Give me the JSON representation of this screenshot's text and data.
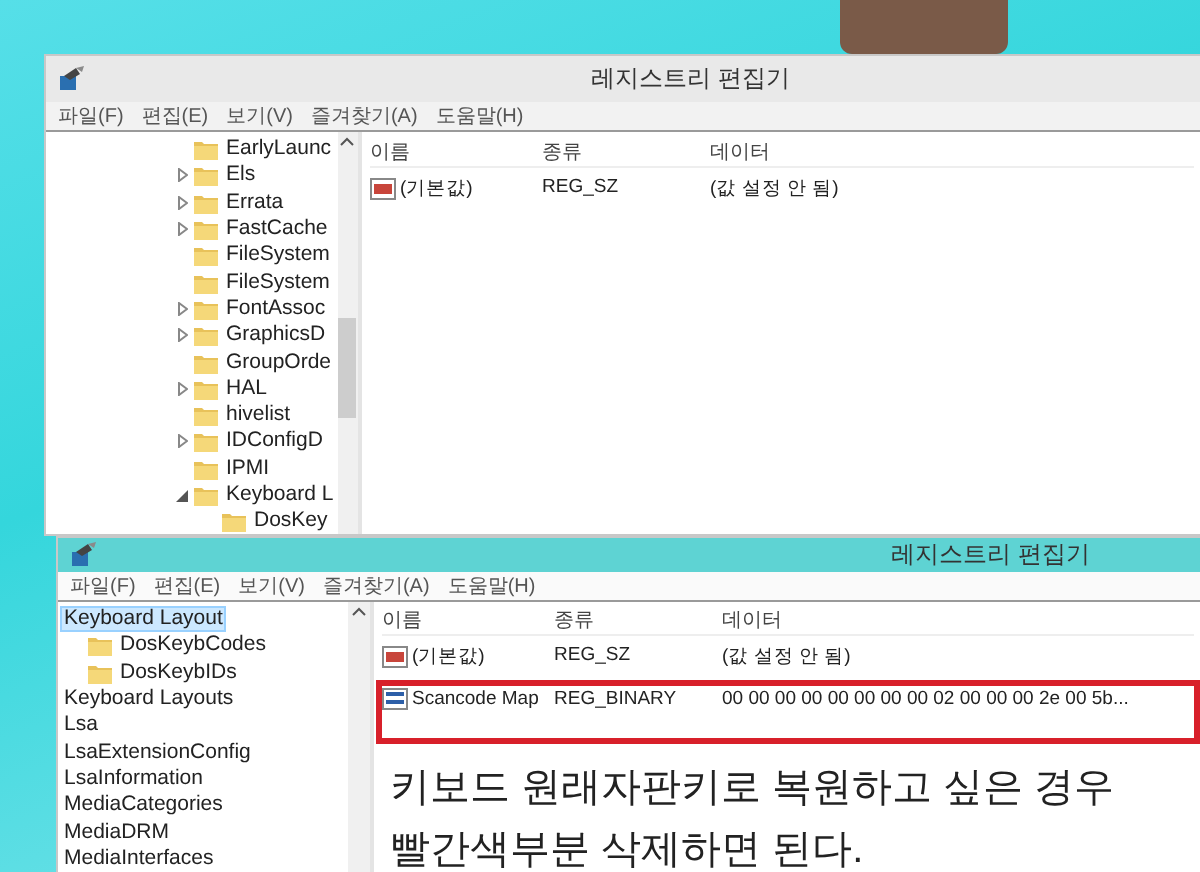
{
  "windows": [
    {
      "title": "레지스트리 편집기",
      "active": false,
      "menu": [
        "파일(F)",
        "편집(E)",
        "보기(V)",
        "즐겨찾기(A)",
        "도움말(H)"
      ],
      "tree": [
        {
          "label": "EarlyLaunc",
          "kind": "leaf",
          "selected": false
        },
        {
          "label": "Els",
          "kind": "collapsed",
          "selected": false
        },
        {
          "label": "Errata",
          "kind": "collapsed",
          "selected": false
        },
        {
          "label": "FastCache",
          "kind": "collapsed",
          "selected": false
        },
        {
          "label": "FileSystem",
          "kind": "leaf",
          "selected": false
        },
        {
          "label": "FileSystem",
          "kind": "leaf",
          "selected": false
        },
        {
          "label": "FontAssoc",
          "kind": "collapsed",
          "selected": false
        },
        {
          "label": "GraphicsD",
          "kind": "collapsed",
          "selected": false
        },
        {
          "label": "GroupOrde",
          "kind": "leaf",
          "selected": false
        },
        {
          "label": "HAL",
          "kind": "collapsed",
          "selected": false
        },
        {
          "label": "hivelist",
          "kind": "leaf",
          "selected": false
        },
        {
          "label": "IDConfigD",
          "kind": "collapsed",
          "selected": false
        },
        {
          "label": "IPMI",
          "kind": "leaf",
          "selected": false
        },
        {
          "label": "Keyboard L",
          "kind": "expanded",
          "selected": false,
          "children": [
            {
              "label": "DosKey",
              "kind": "leaf",
              "selected": false
            }
          ]
        }
      ],
      "columns": [
        "이름",
        "종류",
        "데이터"
      ],
      "rows": [
        {
          "kind": "string",
          "name": "(기본값)",
          "type": "REG_SZ",
          "data": "(값 설정 안 됨)",
          "marked": false
        }
      ]
    },
    {
      "title": "레지스트리 편집기",
      "active": true,
      "menu": [
        "파일(F)",
        "편집(E)",
        "보기(V)",
        "즐겨찾기(A)",
        "도움말(H)"
      ],
      "tree": [
        {
          "label": "Keyboard Layout",
          "selected": true,
          "children": [
            {
              "label": "DosKeybCodes",
              "selected": false
            },
            {
              "label": "DosKeybIDs",
              "selected": false
            }
          ]
        },
        {
          "label": "Keyboard Layouts",
          "selected": false
        },
        {
          "label": "Lsa",
          "selected": false
        },
        {
          "label": "LsaExtensionConfig",
          "selected": false
        },
        {
          "label": "LsaInformation",
          "selected": false
        },
        {
          "label": "MediaCategories",
          "selected": false
        },
        {
          "label": "MediaDRM",
          "selected": false
        },
        {
          "label": "MediaInterfaces",
          "selected": false
        }
      ],
      "columns": [
        "이름",
        "종류",
        "데이터"
      ],
      "rows": [
        {
          "kind": "string",
          "name": "(기본값)",
          "type": "REG_SZ",
          "data": "(값 설정 안 됨)",
          "marked": false
        },
        {
          "kind": "binary",
          "name": "Scancode Map",
          "type": "REG_BINARY",
          "data": "00 00 00 00 00 00 00 00 02 00 00 00 2e 00 5b...",
          "marked": true
        }
      ],
      "note": [
        "키보드 원래자판키로 복원하고 싶은 경우",
        "빨간색부분 삭제하면 된다."
      ]
    }
  ]
}
